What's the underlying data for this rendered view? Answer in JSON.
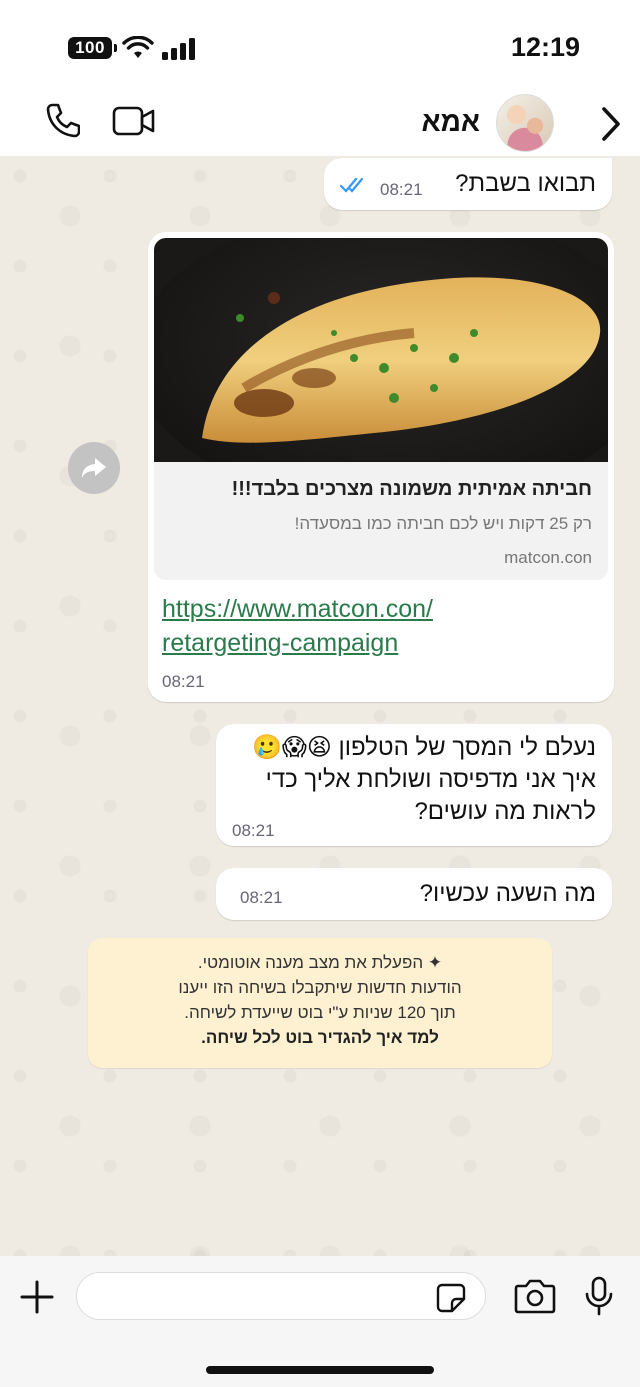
{
  "status_bar": {
    "time": "12:19",
    "battery": "100"
  },
  "header": {
    "contact_name": "אמא"
  },
  "messages": [
    {
      "text": "תבואו בשבת?",
      "time": "08:21"
    },
    {
      "preview_title": "חביתה אמיתית משמונה מצרכים בלבד!!!",
      "preview_description": "רק 25 דקות ויש לכם חביתה כמו במסעדה!",
      "preview_domain": "matcon.con",
      "link_line1": "https://www.matcon.con/",
      "link_line2": "retargeting-campaign",
      "time": "08:21"
    },
    {
      "text": "נעלם לי המסך של הטלפון 😫😱🥲 איך אני מדפיסה ושולחת אליך כדי לראות מה עושים?",
      "time": "08:21"
    },
    {
      "text": "מה השעה עכשיו?",
      "time": "08:21"
    }
  ],
  "notice": {
    "line1": "✦ הפעלת את מצב מענה אוטומטי.",
    "line2": "הודעות חדשות שיתקבלו בשיחה הזו ייענו",
    "line3": "תוך 120 שניות ע\"י בוט שייעדת לשיחה.",
    "link": "למד איך להגדיר בוט לכל שיחה."
  },
  "input": {
    "placeholder": ""
  },
  "colors": {
    "link": "#2b7a4b",
    "notice_bg": "#fdf1d2",
    "read_ticks": "#3497f9"
  }
}
